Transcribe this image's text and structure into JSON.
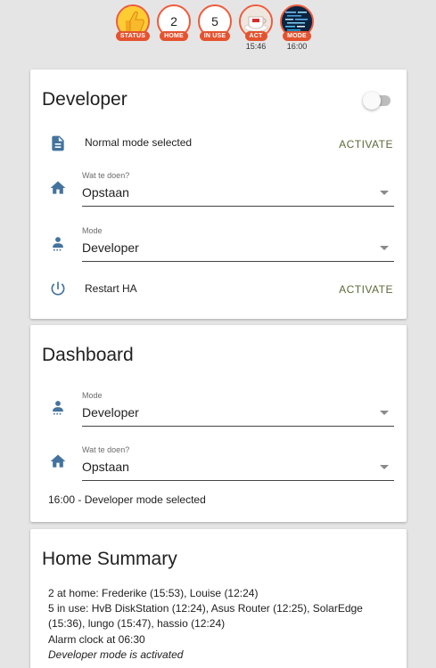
{
  "badges": [
    {
      "label": "STATUS",
      "value": "",
      "icon": "thumbs-up-icon",
      "time": ""
    },
    {
      "label": "HOME",
      "value": "2",
      "icon": "",
      "time": ""
    },
    {
      "label": "IN USE",
      "value": "5",
      "icon": "",
      "time": ""
    },
    {
      "label": "ACT",
      "value": "",
      "icon": "coffee-cup-icon",
      "time": "15:46"
    },
    {
      "label": "MODE",
      "value": "",
      "icon": "code-screen-icon",
      "time": "16:00"
    }
  ],
  "developer_card": {
    "title": "Developer",
    "toggle_on": false,
    "mode_row": {
      "text": "Normal mode selected",
      "action": "ACTIVATE",
      "icon": "document-icon"
    },
    "todo_select": {
      "label": "Wat te doen?",
      "value": "Opstaan",
      "icon": "home-icon"
    },
    "mode_select": {
      "label": "Mode",
      "value": "Developer",
      "icon": "developer-icon"
    },
    "restart_row": {
      "text": "Restart HA",
      "action": "ACTIVATE",
      "icon": "power-icon"
    }
  },
  "dashboard_card": {
    "title": "Dashboard",
    "mode_select": {
      "label": "Mode",
      "value": "Developer",
      "icon": "developer-icon"
    },
    "todo_select": {
      "label": "Wat te doen?",
      "value": "Opstaan",
      "icon": "home-icon"
    },
    "status_text": "16:00 - Developer mode selected"
  },
  "summary_card": {
    "title": "Home Summary",
    "line1": "2 at home: Frederike (15:53), Louise (12:24)",
    "line2": "5 in use: HvB DiskStation (12:24), Asus Router (12:25), SolarEdge (15:36), lungo (15:47), hassio (12:24)",
    "line3": "Alarm clock at 06:30",
    "line4": "Developer mode is activated"
  },
  "colors": {
    "accent_icon": "#44739e",
    "badge_red": "#e4532f",
    "action_text": "#5c6a3a",
    "background": "#e5e5e5"
  }
}
